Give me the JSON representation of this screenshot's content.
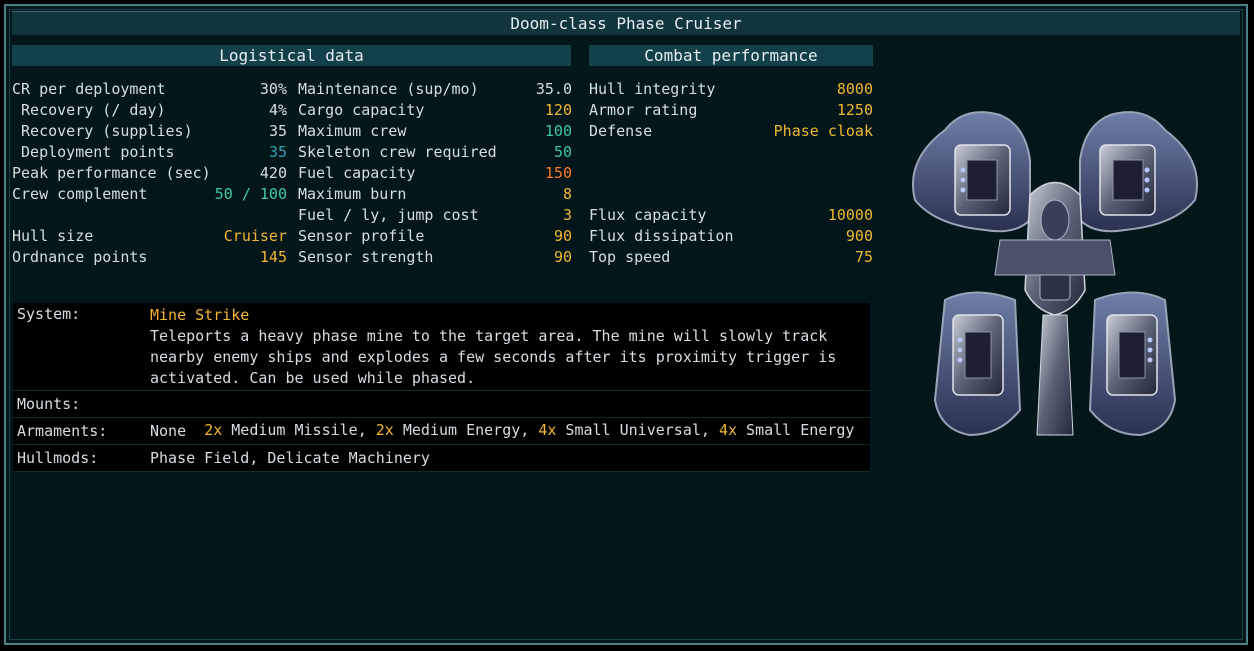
{
  "title": "Doom-class Phase Cruiser",
  "logistics": {
    "header": "Logistical data",
    "col1": [
      {
        "label": "CR per deployment",
        "value": "30%",
        "color": "white"
      },
      {
        "label": " Recovery (/ day)",
        "value": "4%",
        "color": "white"
      },
      {
        "label": " Recovery (supplies)",
        "value": "35",
        "color": "white"
      },
      {
        "label": " Deployment points",
        "value": "35",
        "color": "cyan"
      },
      {
        "label": "Peak performance (sec)",
        "value": "420",
        "color": "white"
      },
      {
        "label": "Crew complement",
        "value": "50 / 100",
        "color": "teal"
      },
      {
        "label": "",
        "value": "",
        "color": "white"
      },
      {
        "label": "Hull size",
        "value": "Cruiser",
        "color": "gold"
      },
      {
        "label": "Ordnance points",
        "value": "145",
        "color": "gold"
      }
    ],
    "col2": [
      {
        "label": "Maintenance (sup/mo)",
        "value": "35.0",
        "color": "white"
      },
      {
        "label": "Cargo capacity",
        "value": "120",
        "color": "gold"
      },
      {
        "label": "Maximum crew",
        "value": "100",
        "color": "teal"
      },
      {
        "label": "Skeleton crew required",
        "value": "50",
        "color": "teal"
      },
      {
        "label": "Fuel capacity",
        "value": "150",
        "color": "orange"
      },
      {
        "label": "Maximum burn",
        "value": "8",
        "color": "gold"
      },
      {
        "label": "Fuel / ly, jump cost",
        "value": "3",
        "color": "gold"
      },
      {
        "label": "Sensor profile",
        "value": "90",
        "color": "gold"
      },
      {
        "label": "Sensor strength",
        "value": "90",
        "color": "gold"
      }
    ]
  },
  "combat": {
    "header": "Combat performance",
    "rows": [
      {
        "label": "Hull integrity",
        "value": "8000",
        "color": "gold"
      },
      {
        "label": "Armor rating",
        "value": "1250",
        "color": "gold"
      },
      {
        "label": "Defense",
        "value": "Phase cloak",
        "color": "gold"
      },
      {
        "label": "",
        "value": "",
        "color": "white"
      },
      {
        "label": "",
        "value": "",
        "color": "white"
      },
      {
        "label": "",
        "value": "",
        "color": "white"
      },
      {
        "label": "Flux capacity",
        "value": "10000",
        "color": "gold"
      },
      {
        "label": "Flux dissipation",
        "value": "900",
        "color": "gold"
      },
      {
        "label": "Top speed",
        "value": "75",
        "color": "gold"
      }
    ]
  },
  "details": {
    "system_label": "System:",
    "system_name": "Mine Strike",
    "system_desc": [
      "Teleports a heavy phase mine to the target area. The mine will slowly track",
      "nearby enemy ships and explodes a few seconds after its proximity trigger is",
      "activated. Can be used while phased."
    ],
    "mounts_label": "Mounts:",
    "mounts": [
      {
        "count": "2x",
        "name": " Medium Missile, "
      },
      {
        "count": "2x",
        "name": " Medium Energy, "
      },
      {
        "count": "4x",
        "name": " Small Universal, "
      },
      {
        "count": "4x",
        "name": " Small Energy"
      }
    ],
    "armaments_label": "Armaments:",
    "armaments": "None",
    "hullmods_label": "Hullmods:",
    "hullmods": "Phase Field, Delicate Machinery"
  },
  "colors": {
    "white": "#d6dde2",
    "gold": "#f2b631",
    "teal": "#3dc9a2",
    "cyan": "#2fa3b5",
    "orange": "#ff7a29"
  },
  "ship_icon": "phase-cruiser-sprite"
}
